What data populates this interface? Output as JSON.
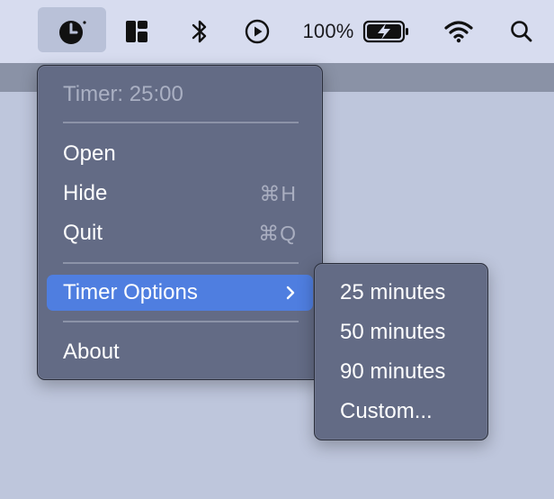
{
  "menubar": {
    "battery_percent": "100%"
  },
  "menu": {
    "title": "Timer: 25:00",
    "items": [
      {
        "label": "Open",
        "shortcut": ""
      },
      {
        "label": "Hide",
        "shortcut": "⌘H"
      },
      {
        "label": "Quit",
        "shortcut": "⌘Q"
      },
      {
        "label": "Timer Options",
        "shortcut": ""
      },
      {
        "label": "About",
        "shortcut": ""
      }
    ]
  },
  "submenu": {
    "items": [
      "25 minutes",
      "50 minutes",
      "90 minutes",
      "Custom..."
    ]
  },
  "colors": {
    "menubar": "#d7dcef",
    "menu_bg": "#636b85",
    "highlight": "#4f7ee0",
    "desktop": "#bec6dc"
  },
  "icons": {
    "menubar": [
      "clock-icon",
      "layout-icon",
      "bluetooth-icon",
      "play-icon",
      "battery-charging-icon",
      "wifi-icon",
      "search-icon"
    ]
  }
}
